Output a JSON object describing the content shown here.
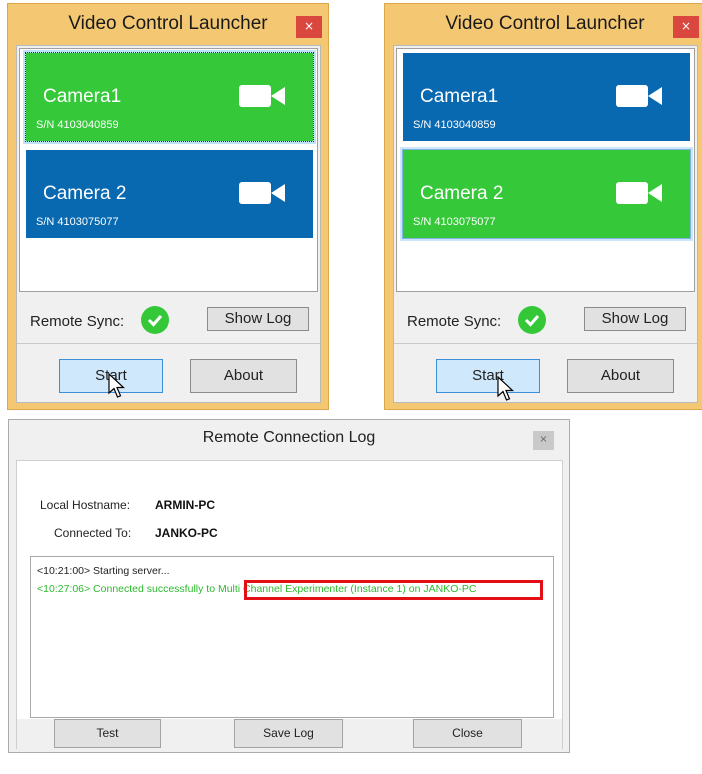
{
  "launcher_left": {
    "title": "Video Control Launcher",
    "close_glyph": "×",
    "cameras": [
      {
        "name": "Camera1",
        "serial": "S/N 4103040859",
        "state": "selected",
        "color": "#35c93a"
      },
      {
        "name": "Camera 2",
        "serial": "S/N 4103075077",
        "state": "normal",
        "color": "#0868b0"
      }
    ],
    "remote_sync_label": "Remote Sync:",
    "show_log_label": "Show Log",
    "start_label": "Start",
    "about_label": "About"
  },
  "launcher_right": {
    "title": "Video Control Launcher",
    "close_glyph": "×",
    "cameras": [
      {
        "name": "Camera1",
        "serial": "S/N 4103040859",
        "state": "normal",
        "color": "#0868b0"
      },
      {
        "name": "Camera 2",
        "serial": "S/N 4103075077",
        "state": "selected",
        "color": "#35c93a"
      }
    ],
    "remote_sync_label": "Remote Sync:",
    "show_log_label": "Show Log",
    "start_label": "Start",
    "about_label": "About"
  },
  "log_window": {
    "title": "Remote Connection Log",
    "close_glyph": "×",
    "local_hostname_label": "Local Hostname:",
    "local_hostname_value": "ARMIN-PC",
    "connected_to_label": "Connected To:",
    "connected_to_value": "JANKO-PC",
    "log_lines": [
      {
        "text": "<10:21:00>  Starting server...",
        "color": "#222222"
      },
      {
        "text": "<10:27:06>  Connected successfully to Multi Channel Experimenter (Instance 1) on JANKO-PC",
        "color": "#2db92f"
      }
    ],
    "test_label": "Test",
    "save_log_label": "Save Log",
    "close_label": "Close"
  },
  "colors": {
    "titlebar_orange": "#f4c872",
    "camera_green": "#35c93a",
    "camera_blue": "#0868b0",
    "sync_ok": "#34c838",
    "highlight_red": "#e40f14",
    "close_red": "#d9473f"
  }
}
